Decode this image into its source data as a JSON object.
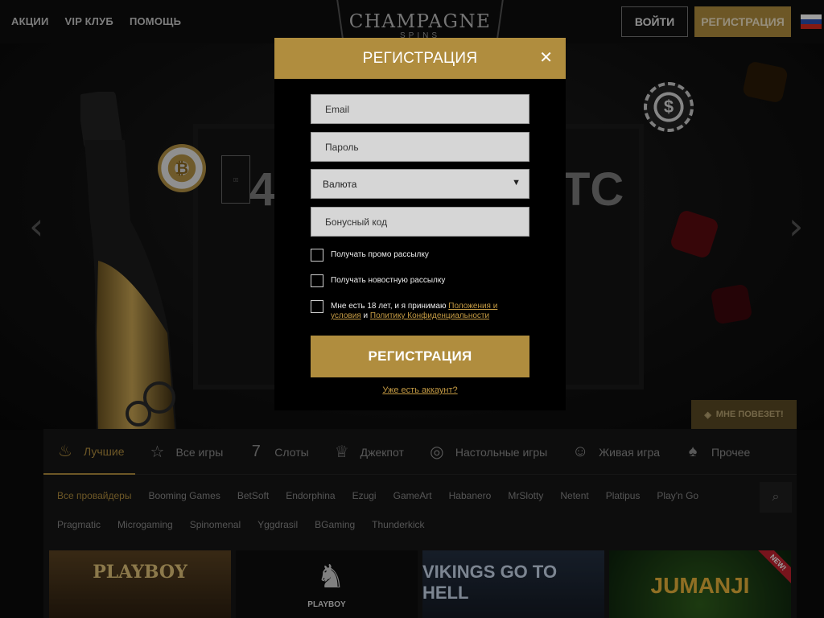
{
  "header": {
    "nav": [
      "АКЦИИ",
      "VIP КЛУБ",
      "ПОМОЩЬ"
    ],
    "logo": "CHAMPAGNE",
    "logo_sub": "SPINS",
    "login": "ВОЙТИ",
    "register": "РЕГИСТРАЦИЯ",
    "language_flag": "russian-flag-icon"
  },
  "hero": {
    "banner_text_left": "4",
    "banner_text_right": "ТС",
    "chip_left_symbol": "₿",
    "chip_right_symbol": "$",
    "lucky_button": "МНЕ ПОВЕЗЕТ!"
  },
  "games": {
    "categories": [
      "Лучшие",
      "Все игры",
      "Слоты",
      "Джекпот",
      "Настольные игры",
      "Живая игра",
      "Прочее"
    ],
    "providers": [
      "Все провайдеры",
      "Booming Games",
      "BetSoft",
      "Endorphina",
      "Ezugi",
      "GameArt",
      "Habanero",
      "MrSlotty",
      "Netent",
      "Platipus",
      "Play'n Go",
      "Pragmatic",
      "Microgaming",
      "Spinomenal",
      "Yggdrasil",
      "BGaming",
      "Thunderkick"
    ],
    "thumbs": [
      "PLAYBOY",
      "PLAYBOY",
      "VIKINGS GO TO HELL",
      "JUMANJI"
    ],
    "new_badge": "NEW!"
  },
  "modal": {
    "title": "РЕГИСТРАЦИЯ",
    "email_placeholder": "Email",
    "password_placeholder": "Пароль",
    "currency": "Валюта",
    "bonus_placeholder": "Бонусный код",
    "promo_label": "Получать промо рассылку",
    "news_label": "Получать новостную рассылку",
    "terms_prefix": "Мне есть 18 лет, и я принимаю ",
    "terms_link": "Положения и условия",
    "terms_and": " и ",
    "privacy_link": "Политику Конфиденциальности",
    "submit": "РЕГИСТРАЦИЯ",
    "have_account": "Уже есть аккаунт?"
  },
  "colors": {
    "accent_gold": "#b08d3e",
    "background": "#0a0a0a"
  }
}
